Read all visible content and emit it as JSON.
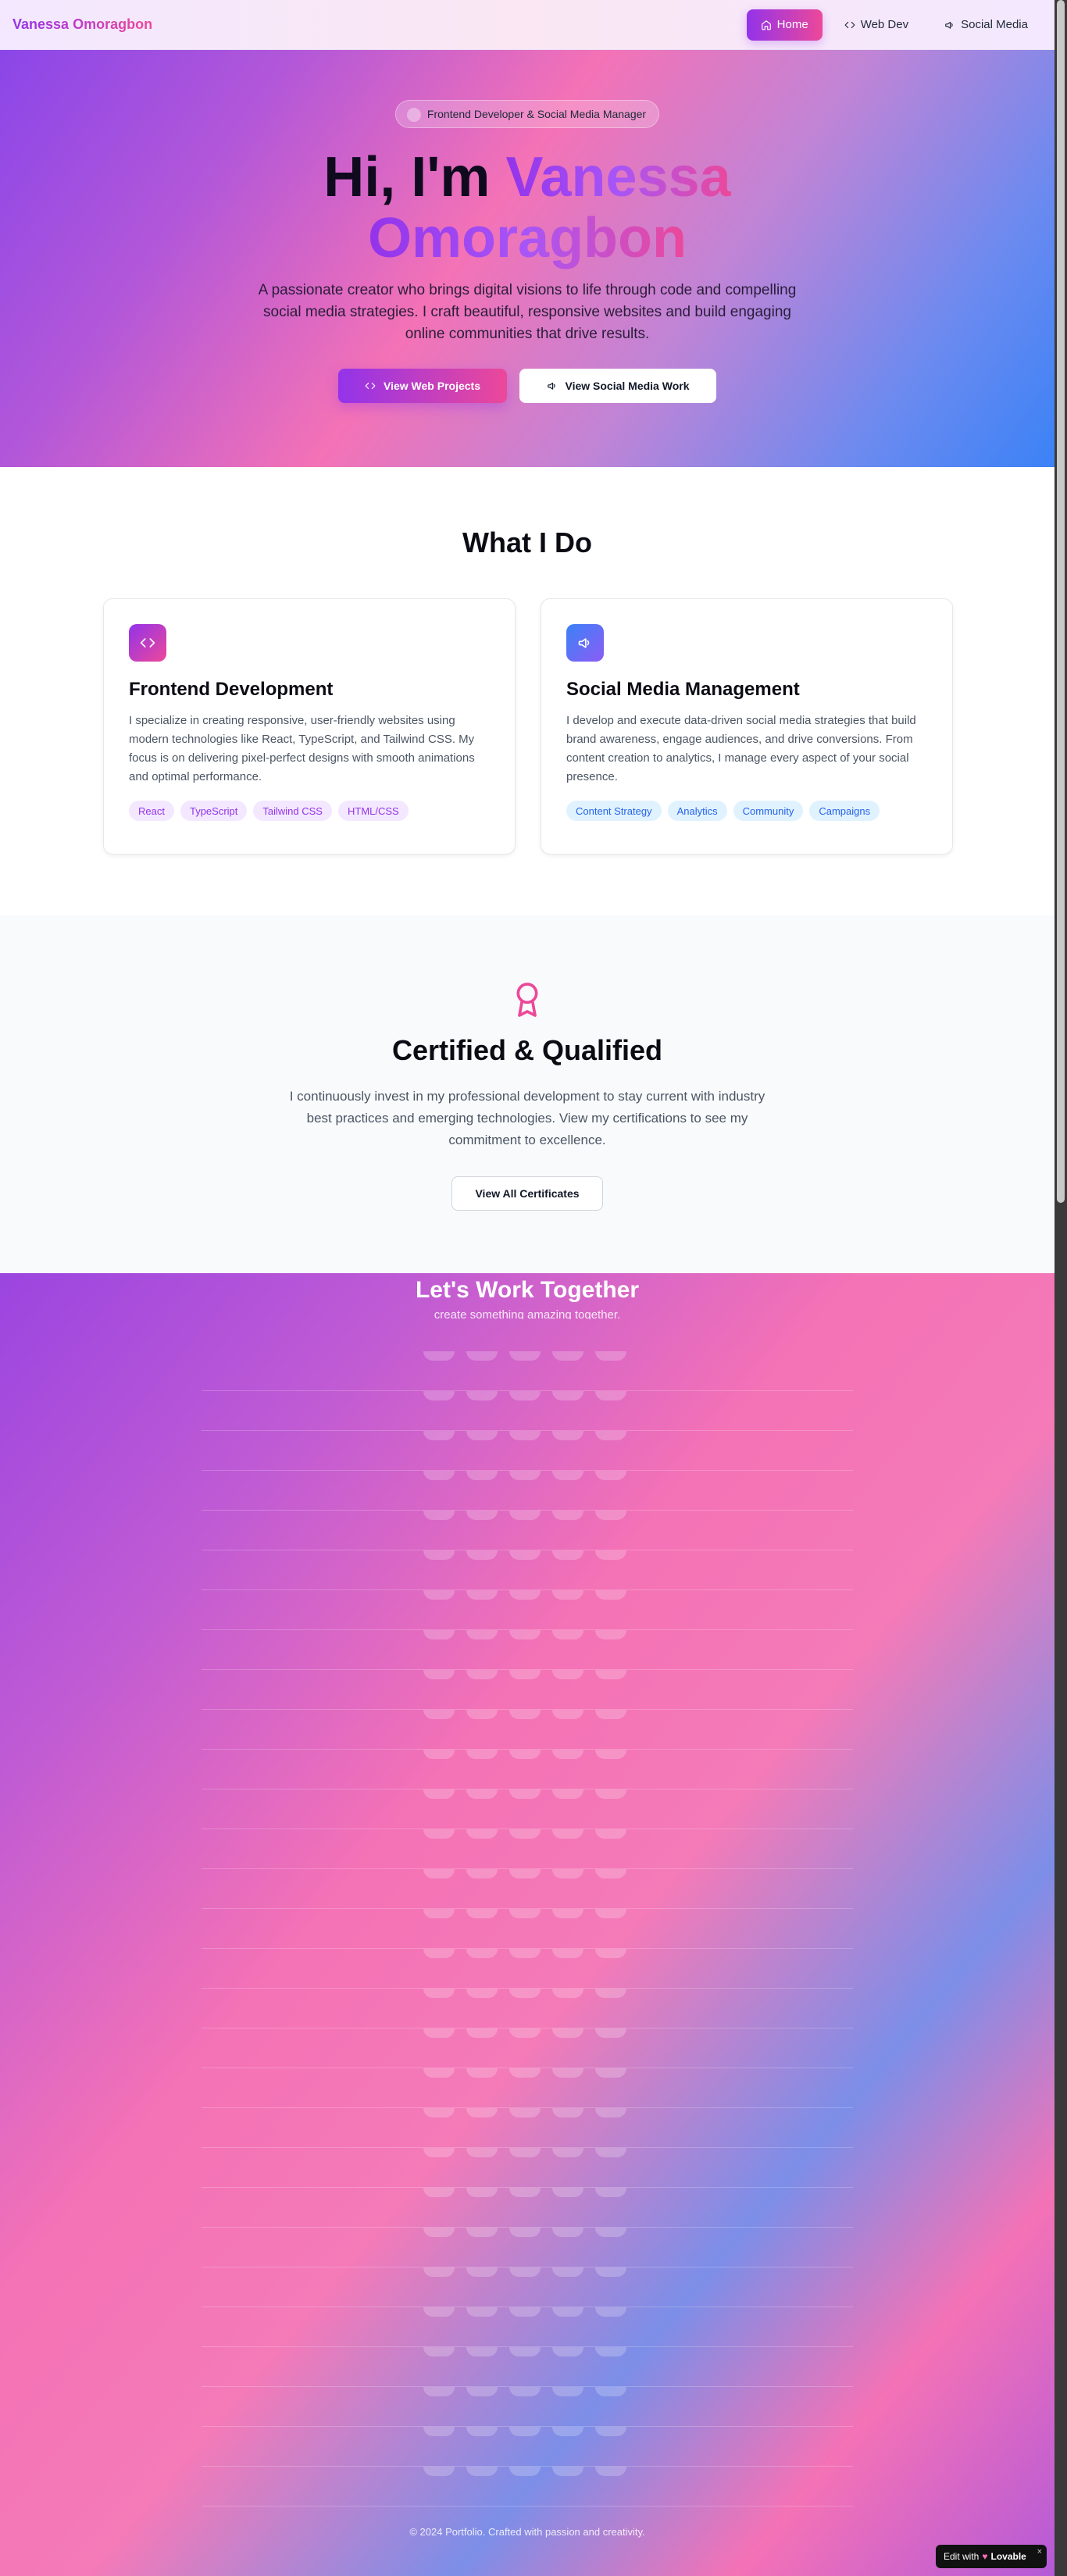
{
  "nav": {
    "brand": "Vanessa Omoragbon",
    "links": [
      {
        "label": "Home",
        "icon": "home-icon",
        "active": true
      },
      {
        "label": "Web Dev",
        "icon": "code-icon",
        "active": false
      },
      {
        "label": "Social Media",
        "icon": "megaphone-icon",
        "active": false
      }
    ]
  },
  "hero": {
    "badge": "Frontend Developer & Social Media Manager",
    "greeting": "Hi, I'm",
    "name_first": "Vanessa",
    "name_last": "Omoragbon",
    "lead": "A passionate creator who brings digital visions to life through code and compelling social media strategies. I craft beautiful, responsive websites and build engaging online communities that drive results.",
    "btn_primary": "View Web Projects",
    "btn_secondary": "View Social Media Work"
  },
  "whatido": {
    "title": "What I Do",
    "cards": [
      {
        "title": "Frontend Development",
        "icon": "code-icon",
        "text": "I specialize in creating responsive, user-friendly websites using modern technologies like React, TypeScript, and Tailwind CSS. My focus is on delivering pixel-perfect designs with smooth animations and optimal performance.",
        "tags": [
          "React",
          "TypeScript",
          "Tailwind CSS",
          "HTML/CSS"
        ]
      },
      {
        "title": "Social Media Management",
        "icon": "megaphone-icon",
        "text": "I develop and execute data-driven social media strategies that build brand awareness, engage audiences, and drive conversions. From content creation to analytics, I manage every aspect of your social presence.",
        "tags": [
          "Content Strategy",
          "Analytics",
          "Community",
          "Campaigns"
        ]
      }
    ]
  },
  "cert": {
    "icon": "award-icon",
    "title": "Certified & Qualified",
    "text": "I continuously invest in my professional development to stay current with industry best practices and emerging technologies. View my certifications to see my commitment to excellence.",
    "button": "View All Certificates"
  },
  "work": {
    "title": "Let's Work Together",
    "subtitle": "create something amazing together.",
    "footer": "© 2024 Portfolio. Crafted with passion and creativity."
  },
  "lovable": {
    "prefix": "Edit with",
    "brand": "Lovable",
    "close": "×"
  },
  "colors": {
    "accent_purple": "#9333ea",
    "accent_pink": "#ec4899",
    "accent_blue": "#3b82f6"
  }
}
